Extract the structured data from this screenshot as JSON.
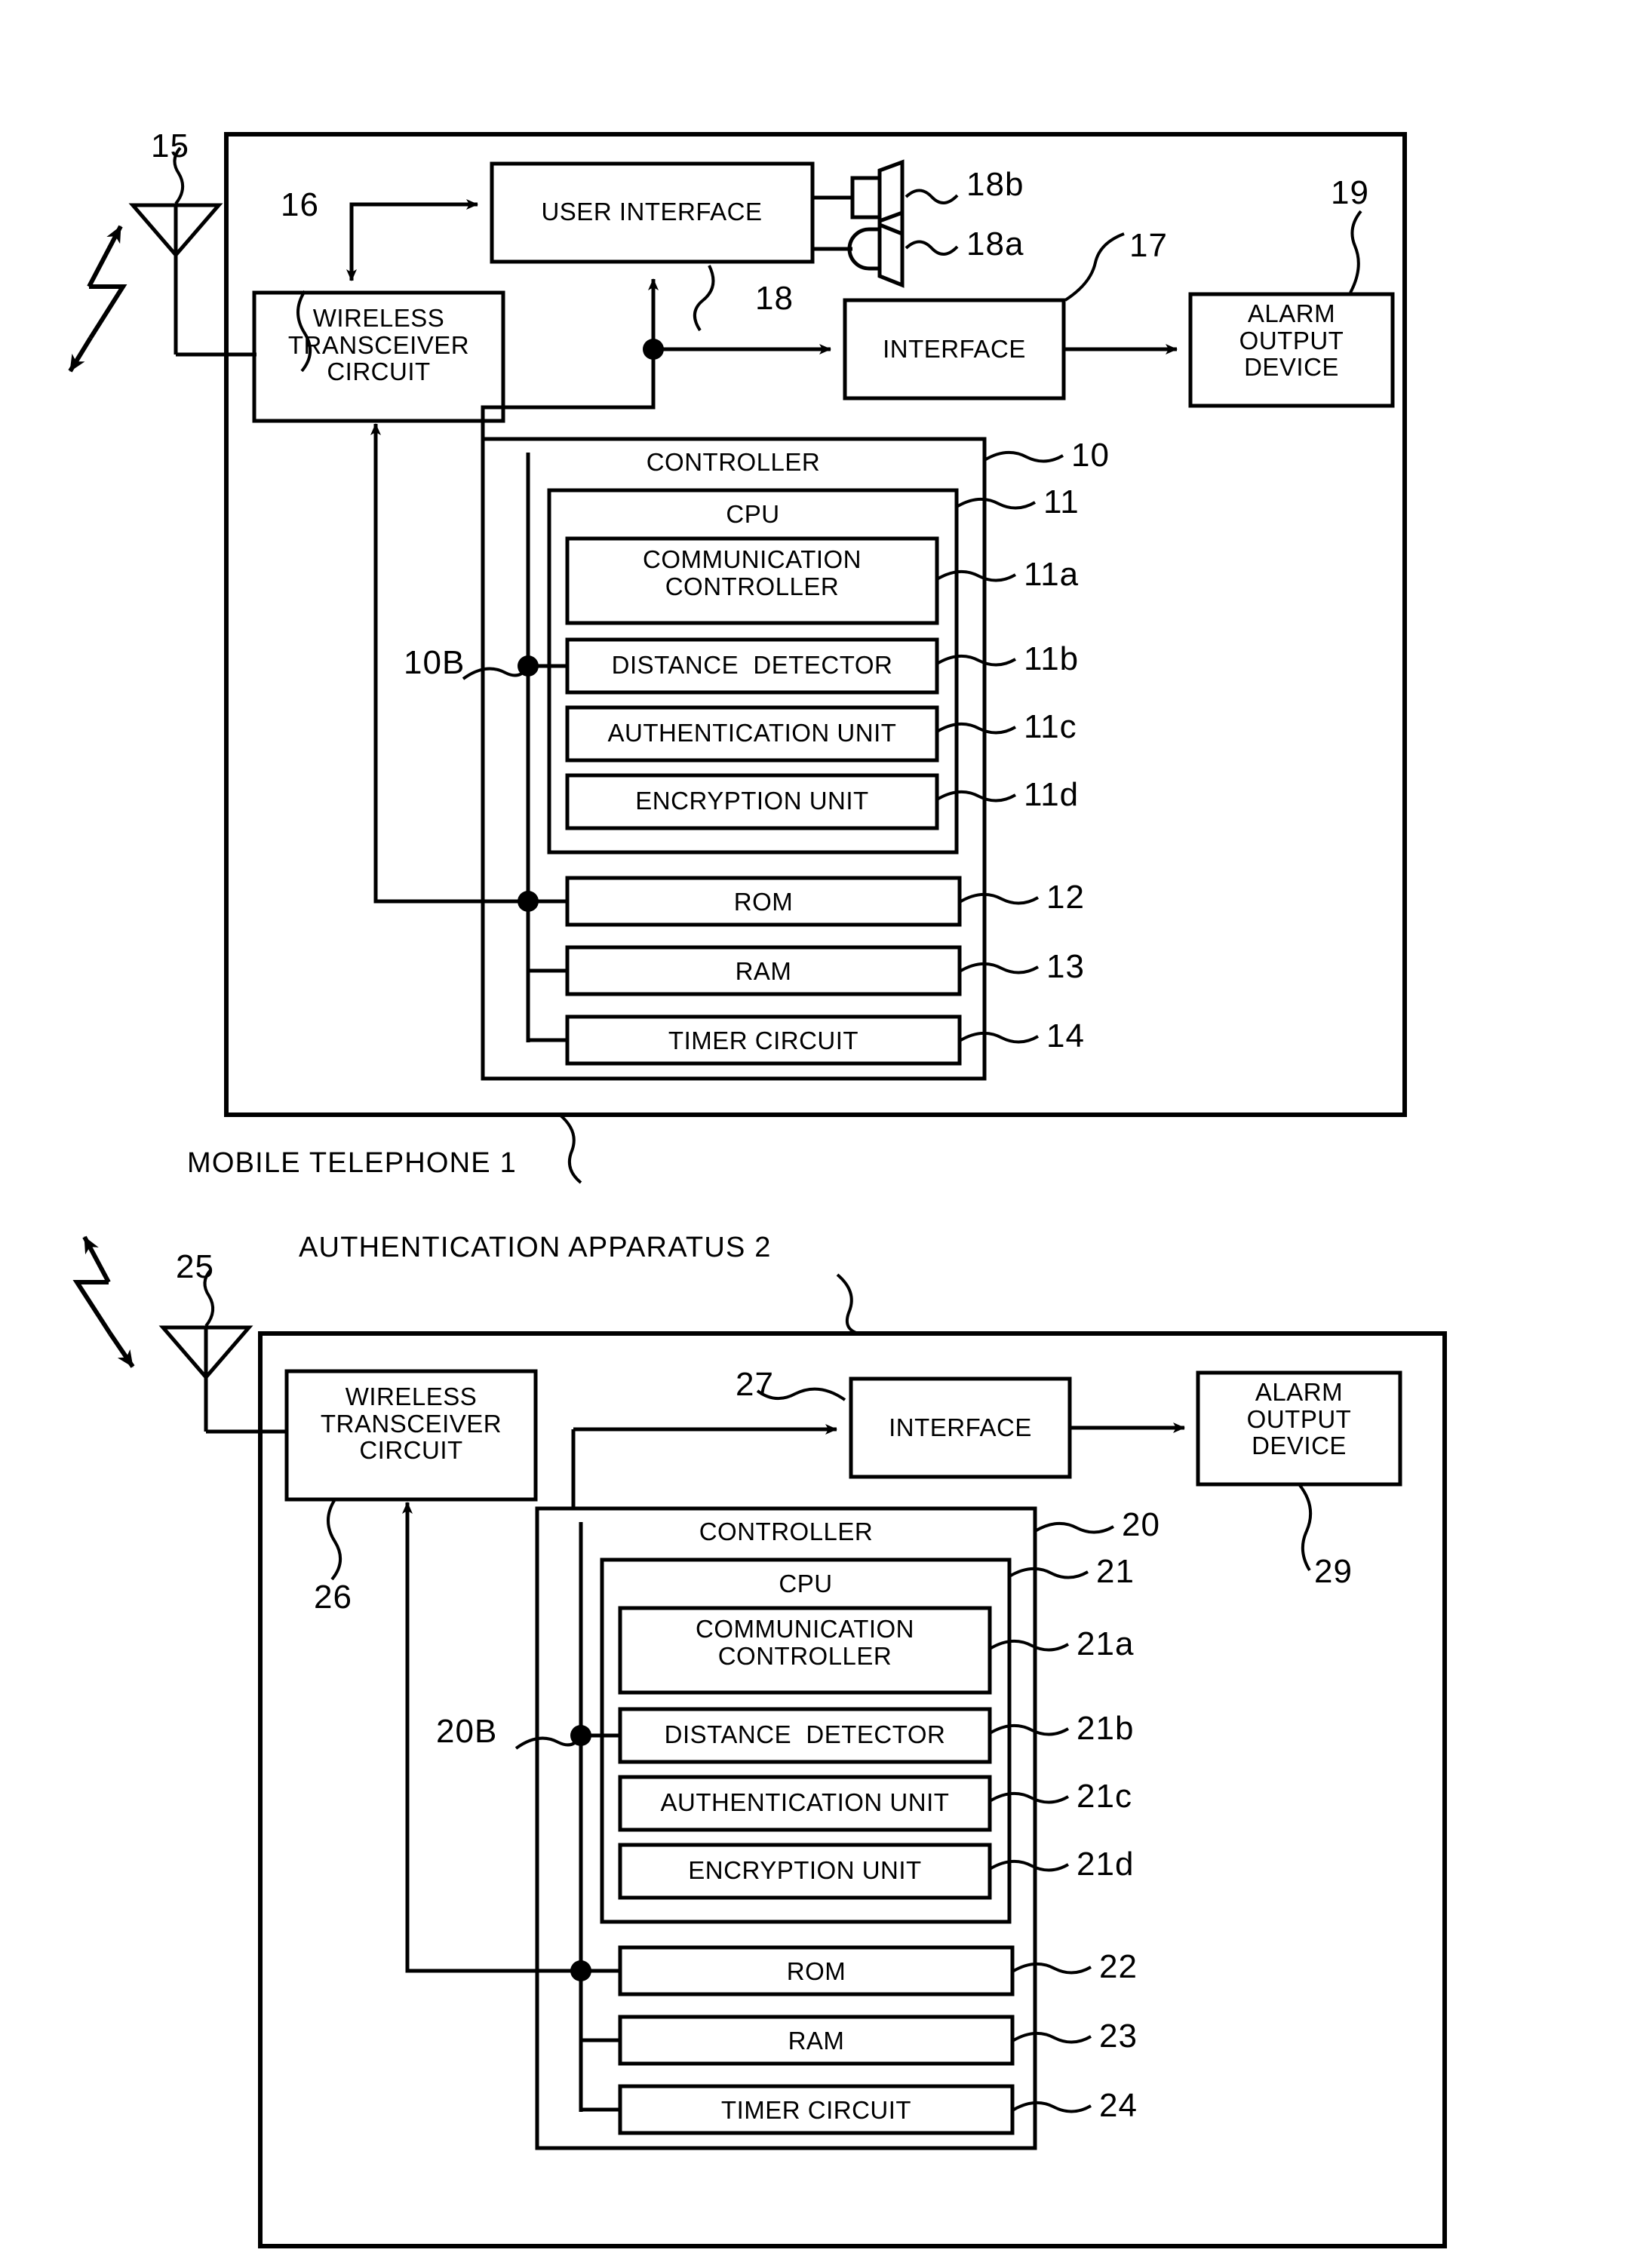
{
  "figure": {
    "type": "patent-block-diagram",
    "captions": {
      "mobile_telephone": "MOBILE TELEPHONE 1",
      "authentication_apparatus": "AUTHENTICATION APPARATUS 2"
    }
  },
  "mobile": {
    "antenna_ref": "15",
    "wireless_transceiver": {
      "label": "WIRELESS\nTRANSCEIVER\nCIRCUIT",
      "ref": "16"
    },
    "user_interface": {
      "label": "USER INTERFACE",
      "ref": "18"
    },
    "speaker": {
      "ref": "18b",
      "icon": "speaker-icon"
    },
    "microphone": {
      "ref": "18a",
      "icon": "microphone-icon"
    },
    "interface": {
      "label": "INTERFACE",
      "ref": "17"
    },
    "alarm_output_device": {
      "label": "ALARM\nOUTPUT\nDEVICE",
      "ref": "19"
    },
    "controller": {
      "label": "CONTROLLER",
      "ref": "10"
    },
    "bus_ref": "10B",
    "cpu": {
      "label": "CPU",
      "ref": "11"
    },
    "cpu_units": [
      {
        "label": "COMMUNICATION\nCONTROLLER",
        "ref": "11a"
      },
      {
        "label": "DISTANCE  DETECTOR",
        "ref": "11b"
      },
      {
        "label": "AUTHENTICATION UNIT",
        "ref": "11c"
      },
      {
        "label": "ENCRYPTION UNIT",
        "ref": "11d"
      }
    ],
    "memories": [
      {
        "label": "ROM",
        "ref": "12"
      },
      {
        "label": "RAM",
        "ref": "13"
      },
      {
        "label": "TIMER CIRCUIT",
        "ref": "14"
      }
    ]
  },
  "apparatus": {
    "antenna_ref": "25",
    "wireless_transceiver": {
      "label": "WIRELESS\nTRANSCEIVER\nCIRCUIT",
      "ref": "26"
    },
    "interface": {
      "label": "INTERFACE",
      "ref": "27"
    },
    "alarm_output_device": {
      "label": "ALARM\nOUTPUT\nDEVICE",
      "ref": "29"
    },
    "controller": {
      "label": "CONTROLLER",
      "ref": "20"
    },
    "bus_ref": "20B",
    "cpu": {
      "label": "CPU",
      "ref": "21"
    },
    "cpu_units": [
      {
        "label": "COMMUNICATION\nCONTROLLER",
        "ref": "21a"
      },
      {
        "label": "DISTANCE  DETECTOR",
        "ref": "21b"
      },
      {
        "label": "AUTHENTICATION UNIT",
        "ref": "21c"
      },
      {
        "label": "ENCRYPTION UNIT",
        "ref": "21d"
      }
    ],
    "memories": [
      {
        "label": "ROM",
        "ref": "22"
      },
      {
        "label": "RAM",
        "ref": "23"
      },
      {
        "label": "TIMER CIRCUIT",
        "ref": "24"
      }
    ]
  },
  "colors": {
    "ink": "#000000",
    "paper": "#ffffff"
  }
}
